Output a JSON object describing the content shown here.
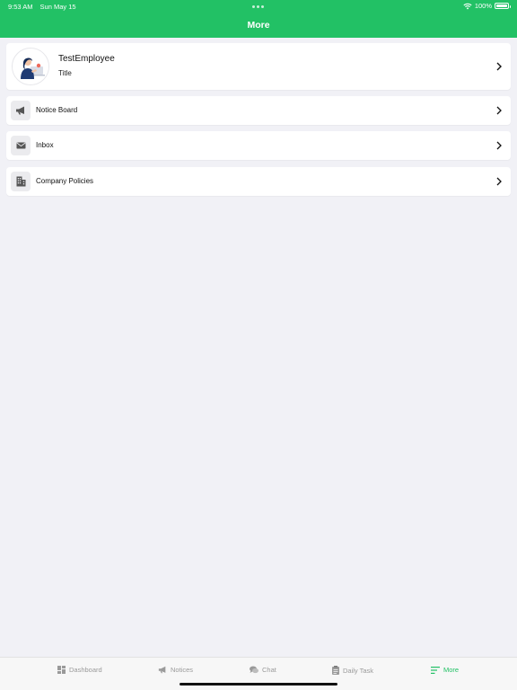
{
  "status_bar": {
    "time": "9:53 AM",
    "date": "Sun May 15",
    "battery": "100%",
    "battery_level": 1.0
  },
  "nav": {
    "title": "More"
  },
  "profile": {
    "name": "TestEmployee",
    "title": "Title"
  },
  "menu": [
    {
      "label": "Notice Board",
      "icon": "megaphone-icon"
    },
    {
      "label": "Inbox",
      "icon": "envelope-icon"
    },
    {
      "label": "Company Policies",
      "icon": "building-icon"
    }
  ],
  "tabs": [
    {
      "label": "Dashboard",
      "icon": "dashboard-icon",
      "active": false
    },
    {
      "label": "Notices",
      "icon": "megaphone-icon",
      "active": false
    },
    {
      "label": "Chat",
      "icon": "chat-icon",
      "active": false
    },
    {
      "label": "Daily Task",
      "icon": "clipboard-icon",
      "active": false
    },
    {
      "label": "More",
      "icon": "menu-lines-icon",
      "active": true
    }
  ],
  "colors": {
    "accent": "#22c165",
    "background": "#f1f1f6",
    "tab_inactive": "#9a9a9a"
  }
}
